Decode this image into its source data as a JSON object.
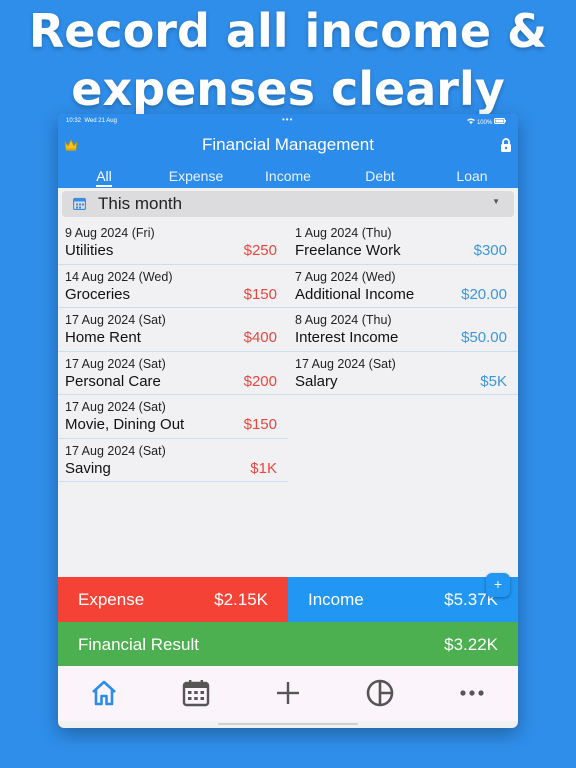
{
  "promo": {
    "line1": "Record all income &",
    "line2": "expenses clearly"
  },
  "statusbar": {
    "time": "10:32",
    "date": "Wed 21 Aug",
    "dots": "•••",
    "battery": "100%"
  },
  "app": {
    "title": "Financial Management",
    "tabs": [
      "All",
      "Expense",
      "Income",
      "Debt",
      "Loan"
    ],
    "active_tab": "All"
  },
  "period": {
    "label": "This month"
  },
  "expenses": [
    {
      "date": "9 Aug 2024 (Fri)",
      "name": "Utilities",
      "amount": "$250"
    },
    {
      "date": "14 Aug 2024 (Wed)",
      "name": "Groceries",
      "amount": "$150"
    },
    {
      "date": "17 Aug 2024 (Sat)",
      "name": "Home Rent",
      "amount": "$400"
    },
    {
      "date": "17 Aug 2024 (Sat)",
      "name": "Personal Care",
      "amount": "$200"
    },
    {
      "date": "17 Aug 2024 (Sat)",
      "name": "Movie, Dining Out",
      "amount": "$150"
    },
    {
      "date": "17 Aug 2024 (Sat)",
      "name": "Saving",
      "amount": "$1K"
    }
  ],
  "incomes": [
    {
      "date": "1 Aug 2024 (Thu)",
      "name": "Freelance Work",
      "amount": "$300"
    },
    {
      "date": "7 Aug 2024 (Wed)",
      "name": "Additional Income",
      "amount": "$20.00"
    },
    {
      "date": "8 Aug 2024 (Thu)",
      "name": "Interest Income",
      "amount": "$50.00"
    },
    {
      "date": "17 Aug 2024 (Sat)",
      "name": "Salary",
      "amount": "$5K"
    }
  ],
  "summary": {
    "expense_label": "Expense",
    "expense_value": "$2.15K",
    "income_label": "Income",
    "income_value": "$5.37K",
    "result_label": "Financial Result",
    "result_value": "$3.22K",
    "fab_label": "+"
  },
  "nav": {
    "items": [
      "home-icon",
      "calendar-icon",
      "add-icon",
      "pie-chart-icon",
      "more-icon"
    ]
  },
  "colors": {
    "background": "#2F8EEA",
    "appbar": "#2C8CEB",
    "expense": "#F44336",
    "income": "#2196F3",
    "result": "#4CAF50",
    "expense_text": "#E8473F",
    "income_text": "#3C97D9"
  }
}
